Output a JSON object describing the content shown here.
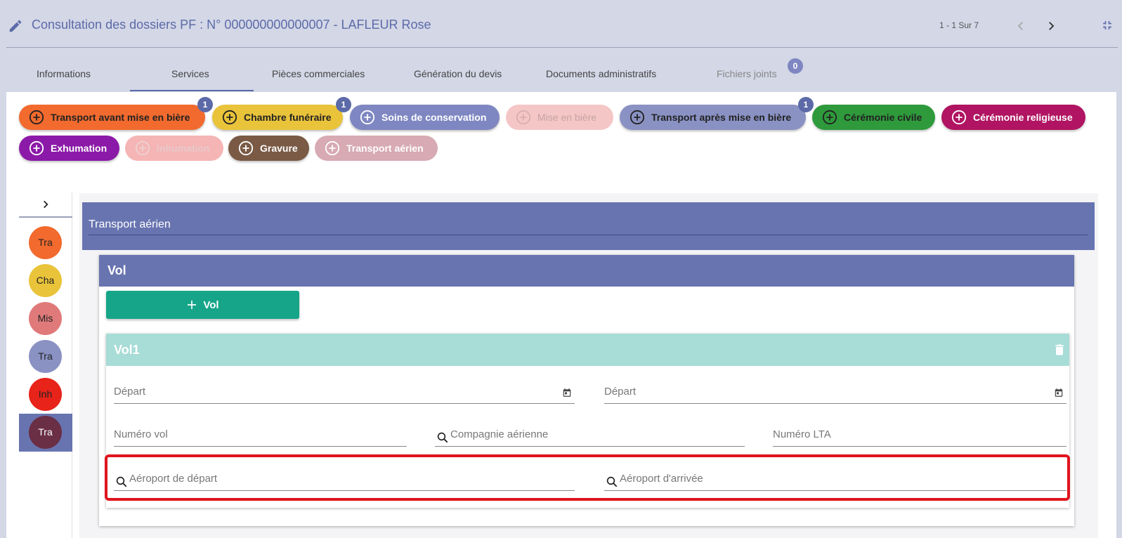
{
  "header": {
    "title": "Consultation des dossiers PF : N° 000000000000007 - LAFLEUR Rose",
    "pager": "1 - 1 Sur 7",
    "icons": [
      "pencil-icon",
      "chevron-left-icon",
      "chevron-right-icon",
      "collapse-icon"
    ]
  },
  "tabs": [
    {
      "label": "Informations"
    },
    {
      "label": "Services",
      "active": true
    },
    {
      "label": "Pièces commerciales"
    },
    {
      "label": "Génération du devis"
    },
    {
      "label": "Documents administratifs"
    },
    {
      "label": "Fichiers joints",
      "badge": "0"
    }
  ],
  "services": [
    {
      "label": "Transport avant mise en bière",
      "color": "#f26a2e",
      "badge": "1"
    },
    {
      "label": "Chambre funéraire",
      "color": "#e9c33a",
      "badge": "1"
    },
    {
      "label": "Soins de conservation",
      "color": "#7f87c2"
    },
    {
      "label": "Mise en bière",
      "color": "#f5c6c6"
    },
    {
      "label": "Transport après mise en bière",
      "color": "#8a92c4",
      "badge": "1"
    },
    {
      "label": "Cérémonie civile",
      "color": "#2e9a3b"
    },
    {
      "label": "Cérémonie religieuse",
      "color": "#b01462"
    },
    {
      "label": "Exhumation",
      "color": "#8b1aa8"
    },
    {
      "label": "Inhumation",
      "color": "#f5b5b5"
    },
    {
      "label": "Gravure",
      "color": "#7a5a45"
    },
    {
      "label": "Transport aérien",
      "color": "#d7aab4"
    }
  ],
  "rail": {
    "avatars": [
      {
        "label": "Tra",
        "color": "#f26a2e"
      },
      {
        "label": "Cha",
        "color": "#e9c33a"
      },
      {
        "label": "Mis",
        "color": "#e07a7a"
      },
      {
        "label": "Tra",
        "color": "#8a92c4"
      },
      {
        "label": "Inh",
        "color": "#e8231a"
      },
      {
        "label": "Tra",
        "color": "#6a2e45"
      }
    ]
  },
  "section": {
    "title": "Transport aérien",
    "card_title": "Vol",
    "add_button": "Vol",
    "vol": {
      "title": "Vol1",
      "fields": {
        "depart_1": "Départ",
        "depart_2": "Départ",
        "numero_vol": "Numéro vol",
        "compagnie": "Compagnie aérienne",
        "numero_lta": "Numéro LTA",
        "aeroport_depart": "Aéroport de départ",
        "aeroport_arrivee": "Aéroport d'arrivée"
      }
    }
  },
  "colors": {
    "accent": "#6874b0",
    "teal": "#17a589",
    "vol_header": "#a8dcd6",
    "highlight": "#e0141e"
  }
}
